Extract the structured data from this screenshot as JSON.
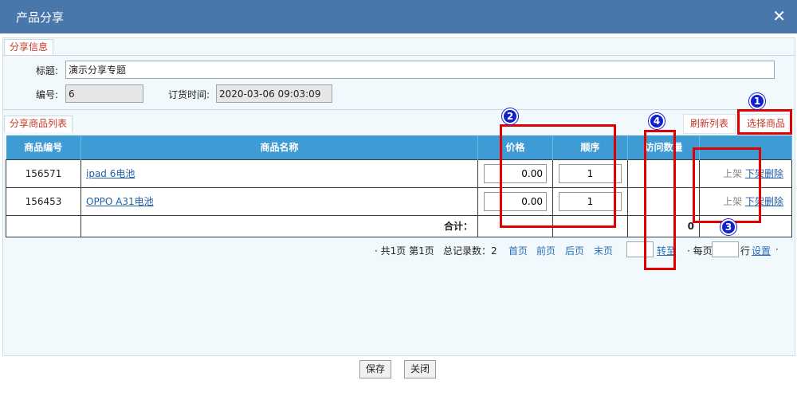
{
  "dialog": {
    "title": "产品分享",
    "close_glyph": "✕"
  },
  "tabs": {
    "info": "分享信息",
    "list": "分享商品列表"
  },
  "form": {
    "title_label": "标题:",
    "title_value": "演示分享专题",
    "code_label": "编号:",
    "code_value": "6",
    "order_time_label": "订货时间:",
    "order_time_value": "2020-03-06 09:03:09"
  },
  "toolbar": {
    "refresh": "刷新列表",
    "select": "选择商品"
  },
  "table": {
    "headers": [
      "商品编号",
      "商品名称",
      "价格",
      "顺序",
      "访问数量",
      ""
    ],
    "rows": [
      {
        "code": "156571",
        "name": "ipad 6电池",
        "price": "0.00",
        "order": "1",
        "visits": "",
        "up": "上架",
        "down": "下架",
        "delete": "删除"
      },
      {
        "code": "156453",
        "name": "OPPO A31电池",
        "price": "0.00",
        "order": "1",
        "visits": "",
        "up": "上架",
        "down": "下架",
        "delete": "删除"
      }
    ],
    "total_label": "合计：",
    "total_value": "0"
  },
  "pager": {
    "summary": "· 共1页 第1页",
    "records": "总记录数：2",
    "first": "首页",
    "prev": "前页",
    "next": "后页",
    "last": "末页",
    "goto": "转至",
    "per_page": "· 每页",
    "row_unit": "行",
    "settings": "设置",
    "end_dot": "·"
  },
  "annotations": [
    "1",
    "2",
    "3",
    "4"
  ],
  "footer": {
    "save": "保存",
    "close": "关闭"
  },
  "colors": {
    "titlebar": "#4a77ab",
    "header": "#3f9bd3",
    "highlight": "#e00000",
    "badge": "#1020d0"
  }
}
